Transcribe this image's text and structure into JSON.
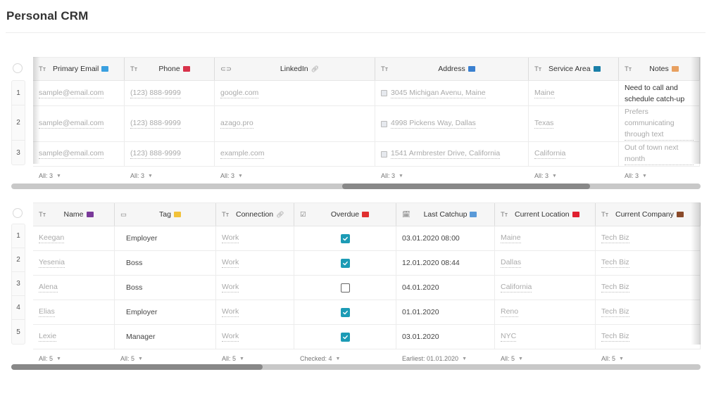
{
  "page": {
    "title": "Personal CRM"
  },
  "table1": {
    "columns": [
      {
        "type_icon": "text-type-icon",
        "type_glyph": "Tт",
        "label": "Primary Email",
        "emoji": "laptop-icon",
        "emoji_color": "#3aa0e0"
      },
      {
        "type_icon": "text-type-icon",
        "type_glyph": "Tт",
        "label": "Phone",
        "emoji": "telephone-icon",
        "emoji_color": "#d8324a"
      },
      {
        "type_icon": "link-type-icon",
        "type_glyph": "⊂⊃",
        "label": "LinkedIn",
        "emoji": "paperclip-icon",
        "emoji_glyph": "🔗︎"
      },
      {
        "type_icon": "text-type-icon",
        "type_glyph": "Tт",
        "label": "Address",
        "emoji": "map-icon",
        "emoji_color": "#3a80d0"
      },
      {
        "type_icon": "text-type-icon",
        "type_glyph": "Tт",
        "label": "Service Area",
        "emoji": "book-icon",
        "emoji_color": "#1a7fa8"
      },
      {
        "type_icon": "text-type-icon",
        "type_glyph": "Tт",
        "label": "Notes",
        "emoji": "memo-icon",
        "emoji_color": "#e8a060"
      }
    ],
    "rows": [
      {
        "num": "1",
        "email": "sample@email.com",
        "phone": "(123) 888-9999",
        "linkedin": "google.com",
        "address": "3045 Michigan Avenu, Maine",
        "service_area": "Maine",
        "notes": "Need to call and schedule catch-up"
      },
      {
        "num": "2",
        "email": "sample@email.com",
        "phone": "(123) 888-9999",
        "linkedin": "azago.pro",
        "address": "4998 Pickens Way, Dallas",
        "service_area": "Texas",
        "notes": "Prefers communicating through text"
      },
      {
        "num": "3",
        "email": "sample@email.com",
        "phone": "(123) 888-9999",
        "linkedin": "example.com",
        "address": "1541 Armbrester Drive, California",
        "service_area": "California",
        "notes": "Out of town next month"
      }
    ],
    "footer": [
      "All: 3",
      "All: 3",
      "All: 3",
      "All: 3",
      "All: 3",
      "All: 3"
    ],
    "scroll": {
      "thumb_start_fraction": 0.48,
      "thumb_end_fraction": 0.84
    }
  },
  "table2": {
    "columns": [
      {
        "type_icon": "text-type-icon",
        "type_glyph": "Tт",
        "label": "Name",
        "emoji": "people-icon",
        "emoji_color": "#7a3a9a"
      },
      {
        "type_icon": "tag-type-icon",
        "type_glyph": "▭",
        "label": "Tag",
        "emoji": "label-icon",
        "emoji_color": "#f2c23a"
      },
      {
        "type_icon": "text-type-icon",
        "type_glyph": "Tт",
        "label": "Connection",
        "emoji": "paperclip-icon",
        "emoji_glyph": "🔗︎"
      },
      {
        "type_icon": "checkbox-type-icon",
        "type_glyph": "☑",
        "label": "Overdue",
        "emoji": "flag-icon",
        "emoji_color": "#e03030"
      },
      {
        "type_icon": "date-type-icon",
        "type_glyph": "🗓︎",
        "label": "Last Catchup",
        "emoji": "calendar-icon",
        "emoji_color": "#5a9ad8"
      },
      {
        "type_icon": "text-type-icon",
        "type_glyph": "Tт",
        "label": "Current Location",
        "emoji": "pushpin-icon",
        "emoji_color": "#e02030"
      },
      {
        "type_icon": "text-type-icon",
        "type_glyph": "Tт",
        "label": "Current Company",
        "emoji": "briefcase-icon",
        "emoji_color": "#8a4a2a"
      }
    ],
    "rows": [
      {
        "num": "1",
        "name": "Keegan",
        "tag": "Employer",
        "connection": "Work",
        "overdue": true,
        "last_catchup": "03.01.2020 08:00",
        "location": "Maine",
        "company": "Tech Biz"
      },
      {
        "num": "2",
        "name": "Yesenia",
        "tag": "Boss",
        "connection": "Work",
        "overdue": true,
        "last_catchup": "12.01.2020 08:44",
        "location": "Dallas",
        "company": "Tech Biz"
      },
      {
        "num": "3",
        "name": "Alena",
        "tag": "Boss",
        "connection": "Work",
        "overdue": false,
        "last_catchup": "04.01.2020",
        "location": "California",
        "company": "Tech Biz"
      },
      {
        "num": "4",
        "name": "Elias",
        "tag": "Employer",
        "connection": "Work",
        "overdue": true,
        "last_catchup": "01.01.2020",
        "location": "Reno",
        "company": "Tech Biz"
      },
      {
        "num": "5",
        "name": "Lexie",
        "tag": "Manager",
        "connection": "Work",
        "overdue": true,
        "last_catchup": "03.01.2020",
        "location": "NYC",
        "company": "Tech Biz"
      }
    ],
    "footer": [
      "All: 5",
      "All: 5",
      "All: 5",
      "Checked: 4",
      "Earliest: 01.01.2020",
      "All: 5",
      "All: 5"
    ],
    "scroll": {
      "thumb_start_fraction": 0.0,
      "thumb_end_fraction": 0.365
    }
  },
  "colors": {
    "checkbox_accent": "#1c9bb5",
    "scroll_thumb": "#888888",
    "scroll_track": "#c8c8c8"
  }
}
